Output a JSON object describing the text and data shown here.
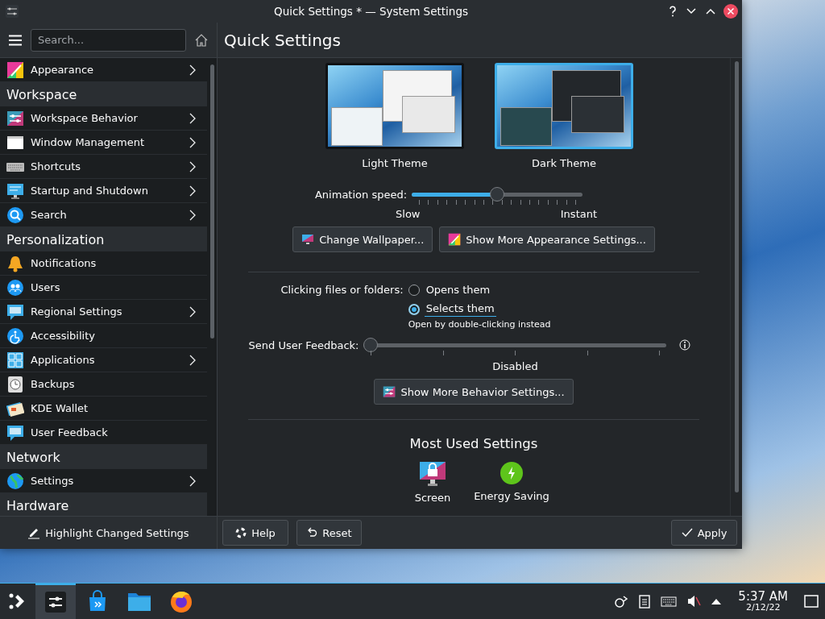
{
  "window": {
    "title": "Quick Settings * — System Settings"
  },
  "sidebar": {
    "search": {
      "placeholder": "Search..."
    },
    "items": [
      {
        "kind": "item",
        "label": "Appearance",
        "chevron": true
      },
      {
        "kind": "header",
        "label": "Workspace"
      },
      {
        "kind": "item",
        "label": "Workspace Behavior",
        "chevron": true
      },
      {
        "kind": "item",
        "label": "Window Management",
        "chevron": true
      },
      {
        "kind": "item",
        "label": "Shortcuts",
        "chevron": true
      },
      {
        "kind": "item",
        "label": "Startup and Shutdown",
        "chevron": true
      },
      {
        "kind": "item",
        "label": "Search",
        "chevron": true
      },
      {
        "kind": "header",
        "label": "Personalization"
      },
      {
        "kind": "item",
        "label": "Notifications",
        "chevron": false
      },
      {
        "kind": "item",
        "label": "Users",
        "chevron": false
      },
      {
        "kind": "item",
        "label": "Regional Settings",
        "chevron": true
      },
      {
        "kind": "item",
        "label": "Accessibility",
        "chevron": false
      },
      {
        "kind": "item",
        "label": "Applications",
        "chevron": true
      },
      {
        "kind": "item",
        "label": "Backups",
        "chevron": false
      },
      {
        "kind": "item",
        "label": "KDE Wallet",
        "chevron": false
      },
      {
        "kind": "item",
        "label": "User Feedback",
        "chevron": false
      },
      {
        "kind": "header",
        "label": "Network"
      },
      {
        "kind": "item",
        "label": "Settings",
        "chevron": true
      },
      {
        "kind": "header",
        "label": "Hardware"
      }
    ],
    "footer_button": "Highlight Changed Settings"
  },
  "page": {
    "title": "Quick Settings",
    "themes": [
      {
        "label": "Light Theme",
        "selected": false,
        "kind": "light"
      },
      {
        "label": "Dark Theme",
        "selected": true,
        "kind": "dark"
      }
    ],
    "animation_speed": {
      "label": "Animation speed:",
      "level": 0.5,
      "min_label": "Slow",
      "max_label": "Instant"
    },
    "appearance_buttons": [
      "Change Wallpaper...",
      "Show More Appearance Settings..."
    ],
    "clicking": {
      "label": "Clicking files or folders:",
      "options": [
        {
          "label": "Opens them",
          "selected": false
        },
        {
          "label": "Selects them",
          "selected": true
        }
      ],
      "hint": "Open by double-clicking instead"
    },
    "feedback": {
      "label": "Send User Feedback:",
      "level": 0,
      "reading": "Disabled"
    },
    "behavior_button": "Show More Behavior Settings...",
    "most_used": {
      "title": "Most Used Settings",
      "items": [
        {
          "label": "Screen"
        },
        {
          "label": "Energy Saving"
        }
      ]
    },
    "footer": {
      "help": "Help",
      "reset": "Reset",
      "apply": "Apply"
    }
  },
  "taskbar": {
    "tasks": [
      {
        "kind": "settings",
        "active": true
      },
      {
        "kind": "store",
        "active": false
      },
      {
        "kind": "files",
        "active": false
      },
      {
        "kind": "browser",
        "active": false
      }
    ],
    "time": "5:37 AM",
    "date": "2/12/22"
  }
}
